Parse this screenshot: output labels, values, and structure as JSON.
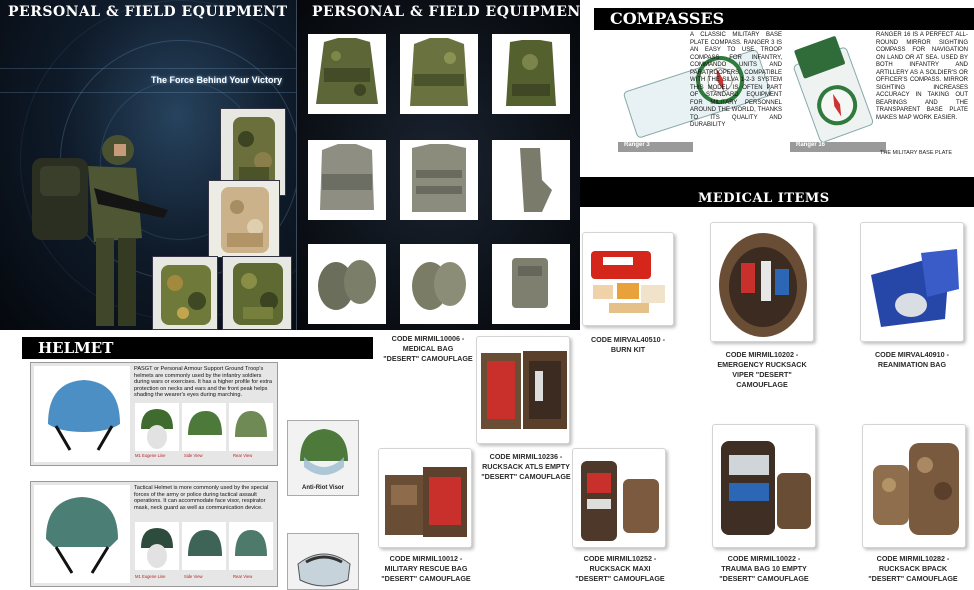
{
  "personal_field": {
    "title_left": "PERSONAL & FIELD EQUIPMENT",
    "title_right": "PERSONAL & FIELD EQUIPMENT",
    "tagline": "The Force Behind Your Victory"
  },
  "compasses": {
    "title": "COMPASSES",
    "items": [
      {
        "label": "Ranger 3",
        "description": "A classic military base plate compass. Ranger 3 is an easy to use troop compass for infantry, commando units and paratroopers. Compatible with the Silva 1-2-3 system this model is often part of standard equipment for military personnel around the world, thanks to its quality and durability"
      },
      {
        "label": "Ranger 16",
        "description": "Ranger 16 is a perfect all-round mirror sighting compass for navigation on land or at sea. Used by both infantry and artillery as a soldier's or officer's compass. Mirror sighting increases accuracy in taking out bearings and the transparent base plate makes map work easier."
      },
      {
        "label": "",
        "description": "The military base plate"
      }
    ]
  },
  "medical": {
    "title": "MEDICAL ITEMS",
    "items": [
      {
        "code": "CODE MIRMIL10006 -\nMEDICAL BAG\n\"DESERT\" CAMOUFLAGE"
      },
      {
        "code": "CODE MIRVAL40510 -\nBURN KIT"
      },
      {
        "code": "CODE MIRMIL10202 -\nEMERGENCY RUCKSACK\nVIPER \"DESERT\"\nCAMOUFLAGE"
      },
      {
        "code": "CODE MIRVAL40910 -\nREANIMATION BAG"
      },
      {
        "code": "CODE MIRMIL10236 -\nRUCKSACK ATLS EMPTY\n\"DESERT\" CAMOUFLAGE"
      },
      {
        "code": "CODE MIRMIL10012 -\nMILITARY RESCUE BAG\n\"DESERT\" CAMOUFLAGE"
      },
      {
        "code": "CODE MIRMIL10252 -\nRUCKSACK MAXI\n\"DESERT\" CAMOUFLAGE"
      },
      {
        "code": "CODE MIRMIL10022 -\nTRAUMA BAG 10 EMPTY\n\"DESERT\" CAMOUFLAGE"
      },
      {
        "code": "CODE MIRMIL10282 -\nRUCKSACK BPACK\n\"DESERT\" CAMOUFLAGE"
      }
    ]
  },
  "helmet": {
    "title": "HELMET",
    "pasgt": {
      "description": "PASGT or Personal Armour Support Ground Troop's helmets are commonly used by the infantry soldiers during wars or exercises. It has a higher profile for extra protection on necks and ears and the front peak helps shading the wearer's eyes during marching.",
      "thumb_labels": [
        "M1 Eugene Line",
        "Side View",
        "Rear View"
      ]
    },
    "tactical": {
      "description": "Tactical Helmet is more commonly used by the special forces of the army or police during tactical assault operations. It can accommodate face visor, respirator mask, neck guard as well as communication device.",
      "thumb_labels": [
        "M1 Eugene Line",
        "Side View",
        "Rear View"
      ]
    },
    "visor_label": "Anti-Riot Visor"
  },
  "colors": {
    "header_bg": "#000000",
    "camo_green": "#5d6b3c",
    "desert_tan": "#b39466",
    "helmet_blue": "#4b8fc4",
    "helmet_teal": "#4b7f76",
    "medical_red": "#c0231c",
    "reanimation_blue": "#2747a8"
  }
}
